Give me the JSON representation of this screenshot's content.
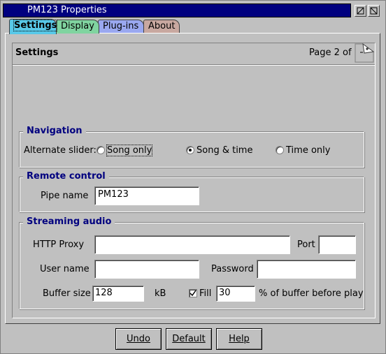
{
  "window": {
    "title": "PM123 Properties",
    "sysmenu_glyph": "⊻"
  },
  "tabs": [
    {
      "label": "Settings",
      "color": "#58c8e8"
    },
    {
      "label": "Display",
      "color": "#80d4a0"
    },
    {
      "label": "Plug-ins",
      "color": "#9aa8f0"
    },
    {
      "label": "About",
      "color": "#c8a8a0"
    }
  ],
  "page": {
    "title": "Settings",
    "indicator": "Page 2 of 2"
  },
  "navigation": {
    "title": "Navigation",
    "alt_slider_label": "Alternate slider:",
    "options": [
      "Song only",
      "Song & time",
      "Time only"
    ],
    "selected": "Song & time"
  },
  "remote": {
    "title": "Remote control",
    "pipe_label": "Pipe name",
    "pipe_value": "PM123"
  },
  "streaming": {
    "title": "Streaming audio",
    "proxy_label": "HTTP Proxy",
    "proxy_value": "",
    "port_label": "Port",
    "port_value": "",
    "user_label": "User name",
    "user_value": "",
    "password_label": "Password",
    "password_value": "",
    "buffer_label": "Buffer size",
    "buffer_value": "128",
    "buffer_unit": "kB",
    "fill_label": "Fill",
    "fill_checked": true,
    "fill_value": "30",
    "fill_suffix": "% of buffer before play"
  },
  "buttons": {
    "undo": "Undo",
    "default": "Default",
    "help": "Help"
  }
}
